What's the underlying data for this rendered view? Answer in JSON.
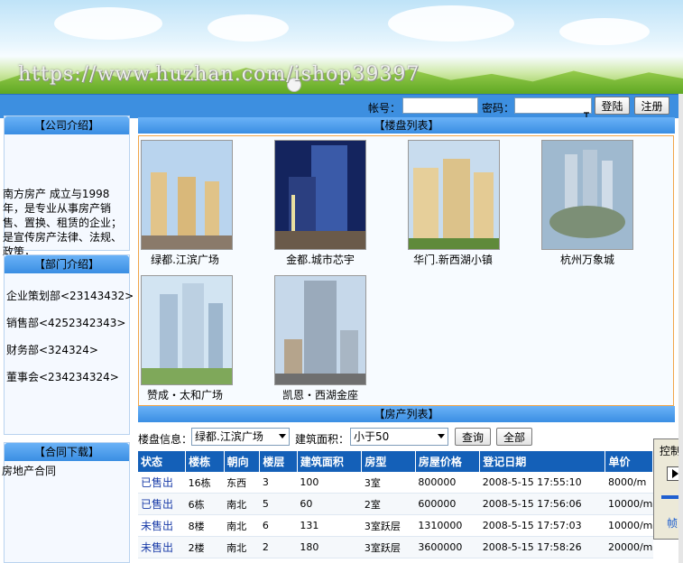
{
  "banner": {
    "watermark": "https://www.huzhan.com/ishop39397"
  },
  "login": {
    "account_label": "帐号：",
    "account_value": "",
    "password_label": "密码：",
    "password_value": "",
    "login_button": "登陆",
    "register_button": "注册"
  },
  "sidebar": {
    "company": {
      "title": "【公司介绍】",
      "text": "南方房产 成立与1998年，是专业从事房产销售、置换、租赁的企业；是宣传房产法律、法规、政策，"
    },
    "departments": {
      "title": "【部门介绍】",
      "items": [
        "企业策划部<23143432>",
        "销售部<4252342343>",
        "财务部<324324>",
        "董事会<234234324>"
      ]
    },
    "contract": {
      "title": "【合同下载】",
      "link": "房地产合同"
    }
  },
  "buildings": {
    "title": "【楼盘列表】",
    "items": [
      {
        "name": "绿都.江滨广场"
      },
      {
        "name": "金都.城市芯宇"
      },
      {
        "name": "华门.新西湖小镇"
      },
      {
        "name": "杭州万象城"
      },
      {
        "name": "赞成・太和广场"
      },
      {
        "name": "凯恩・西湖金座"
      }
    ]
  },
  "houses": {
    "title": "【房产列表】",
    "filter": {
      "building_label": "楼盘信息：",
      "building_value": "绿都.江滨广场",
      "area_label": "建筑面积：",
      "area_value": "小于50",
      "query_button": "查询",
      "all_button": "全部"
    },
    "columns": [
      "状态",
      "楼栋",
      "朝向",
      "楼层",
      "建筑面积",
      "房型",
      "房屋价格",
      "登记日期",
      "单价"
    ],
    "rows": [
      [
        "已售出",
        "16栋",
        "东西",
        "3",
        "100",
        "3室",
        "800000",
        "2008-5-15 17:55:10",
        "8000/m"
      ],
      [
        "已售出",
        "6栋",
        "南北",
        "5",
        "60",
        "2室",
        "600000",
        "2008-5-15 17:56:06",
        "10000/m"
      ],
      [
        "未售出",
        "8楼",
        "南北",
        "6",
        "131",
        "3室跃层",
        "1310000",
        "2008-5-15 17:57:03",
        "10000/m"
      ],
      [
        "未售出",
        "2楼",
        "南北",
        "2",
        "180",
        "3室跃层",
        "3600000",
        "2008-5-15 17:58:26",
        "20000/m"
      ]
    ]
  },
  "control_panel": {
    "title": "控制",
    "frame_label": "帧:"
  },
  "colors": {
    "header_blue": "#3d8fe0",
    "table_header": "#1460b8",
    "gallery_border": "#f2a64a",
    "status_text": "#1a3ca8"
  }
}
